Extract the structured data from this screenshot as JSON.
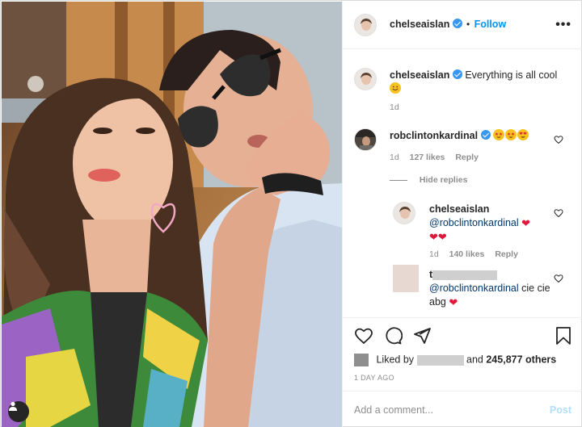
{
  "header": {
    "username": "chelseaislan",
    "follow_separator": "•",
    "follow_label": "Follow",
    "more_icon": "more-dots-icon"
  },
  "caption": {
    "username": "chelseaislan",
    "text": "Everything is all cool",
    "emoji": "smiling-face",
    "time": "1d"
  },
  "comments": [
    {
      "username": "robclintonkardinal",
      "emojis": [
        "star-struck",
        "star-struck",
        "heart-eyes"
      ],
      "time": "1d",
      "likes": "127 likes",
      "reply_label": "Reply",
      "hide_replies_label": "Hide replies"
    }
  ],
  "replies": [
    {
      "username": "chelseaislan",
      "mention": "@robclintonkardinal",
      "time": "1d",
      "likes": "140 likes",
      "reply_label": "Reply"
    },
    {
      "username_visible": "t",
      "mention": "@robclintonkardinal",
      "text": "cie cie abg"
    }
  ],
  "actions": {
    "like_icon": "heart-outline-icon",
    "comment_icon": "comment-bubble-icon",
    "share_icon": "paper-plane-icon",
    "save_icon": "bookmark-icon"
  },
  "liked_by": {
    "prefix": "Liked by",
    "conjunction": "and",
    "others": "245,877 others"
  },
  "date": "1 DAY AGO",
  "add_comment": {
    "placeholder": "Add a comment...",
    "post_label": "Post"
  },
  "colors": {
    "link_blue": "#0095f6",
    "verified_blue": "#3897f0",
    "post_disabled": "#b2dffc",
    "heart_red": "#e0173a"
  }
}
